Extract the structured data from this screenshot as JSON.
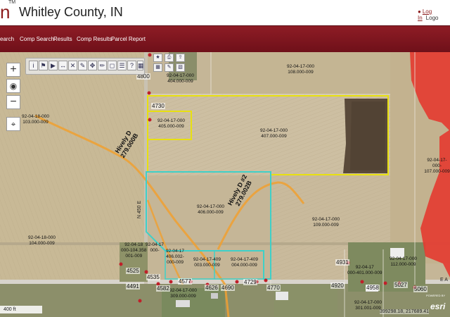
{
  "header": {
    "logo_glyph": "n",
    "trademark": "TM",
    "title": "Whitley County, IN",
    "login_icon": "user-icon",
    "login_label": "Log In",
    "extra_label": "Logo"
  },
  "nav": {
    "items": [
      "earch",
      "Comp Search",
      "Results",
      "Comp Results",
      "Parcel Report"
    ]
  },
  "map_controls": {
    "zoom_in": "+",
    "zoom_out": "−",
    "compass": "◉",
    "locate": "⌖"
  },
  "toolbar_icons": [
    "info-icon",
    "identify-icon",
    "select-icon",
    "measure-icon",
    "clear-icon",
    "draw-icon",
    "pan-icon",
    "pen-icon",
    "zoom-extent-icon",
    "layers-icon",
    "help-icon",
    "map-icon"
  ],
  "toolbar2_icons": [
    "bookmark-icon",
    "print-icon",
    "export-icon",
    "basemap-icon",
    "sketch-icon",
    "save-icon"
  ],
  "parcels": [
    {
      "line1": "92-04-18-000",
      "line2": "103.000-009"
    },
    {
      "line1": "92-04-17-000",
      "line2": "405.000-009"
    },
    {
      "line1": "92-04-17-000",
      "line2": "407.000-009"
    },
    {
      "line1": "92-04-17-000",
      "line2": "108.000-009"
    },
    {
      "line1": "92-04-17-000",
      "line2": "404.000-009"
    },
    {
      "line1": "92-04-17-000",
      "line2": "406.000-009"
    },
    {
      "line1": "92-04-17-000",
      "line2": "109.000-009"
    },
    {
      "line1": "92-04-18-000",
      "line2": "104.000-009"
    },
    {
      "line1": "92-04-17-",
      "line2": "000-107.000-009"
    },
    {
      "line1": "92-04-18",
      "line2": "000-104.358"
    },
    {
      "line1": "92-04-17",
      "line2": "000-"
    },
    {
      "line1": "92-04-17",
      "line2": "406.002-"
    },
    {
      "line1": "92-04-17-409",
      "line2": "003.000-009"
    },
    {
      "line1": "92-04-17-409",
      "line2": "004.000-009"
    },
    {
      "line1": "92-04-17",
      "line2": "000-401.000-009"
    },
    {
      "line1": "92-04-17-000",
      "line2": "112.000-009"
    },
    {
      "line1": "92-04-17-000",
      "line2": "309.000-009"
    },
    {
      "line1": "92-04-17-000",
      "line2": "301.001-009"
    }
  ],
  "parcel_extra": [
    "001-009",
    "000-009",
    "009"
  ],
  "address_numbers": [
    "4800",
    "4730",
    "4525",
    "4491",
    "4535",
    "4582",
    "4577",
    "4626",
    "4690",
    "4729",
    "4770",
    "4931",
    "4920",
    "4958",
    "5027",
    "5060"
  ],
  "drains": [
    {
      "name": "Hively D",
      "id": "279.000B"
    },
    {
      "name": "Hively D #2",
      "id": "279.002B"
    }
  ],
  "road_labels": [
    "N 450 E",
    "E A"
  ],
  "scale": "400 ft",
  "coords": "399298.18, 217689.41",
  "esri": "esri",
  "esri_small": "POWERED BY",
  "colors": {
    "brand": "#8c1c1c",
    "parcel_selected": "#e8e010",
    "parcel_cyan": "#3fd0c8",
    "drain": "#f0a030",
    "flood": "#e83030"
  }
}
